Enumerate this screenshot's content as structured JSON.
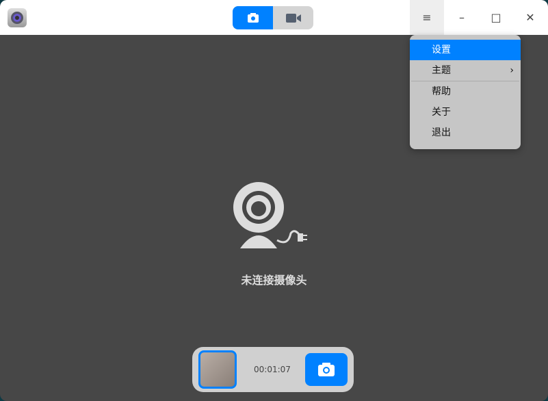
{
  "titlebar": {
    "menu_icon": "≡",
    "minimize_icon": "–",
    "maximize_icon": "□",
    "close_icon": "✕"
  },
  "menu": {
    "items": [
      {
        "label": "设置"
      },
      {
        "label": "主题",
        "submenu": "›"
      },
      {
        "label": "帮助"
      },
      {
        "label": "关于"
      },
      {
        "label": "退出"
      }
    ]
  },
  "main": {
    "status": "未连接摄像头"
  },
  "bottom": {
    "timer": "00:01:07"
  },
  "colors": {
    "accent": "#0081ff"
  }
}
